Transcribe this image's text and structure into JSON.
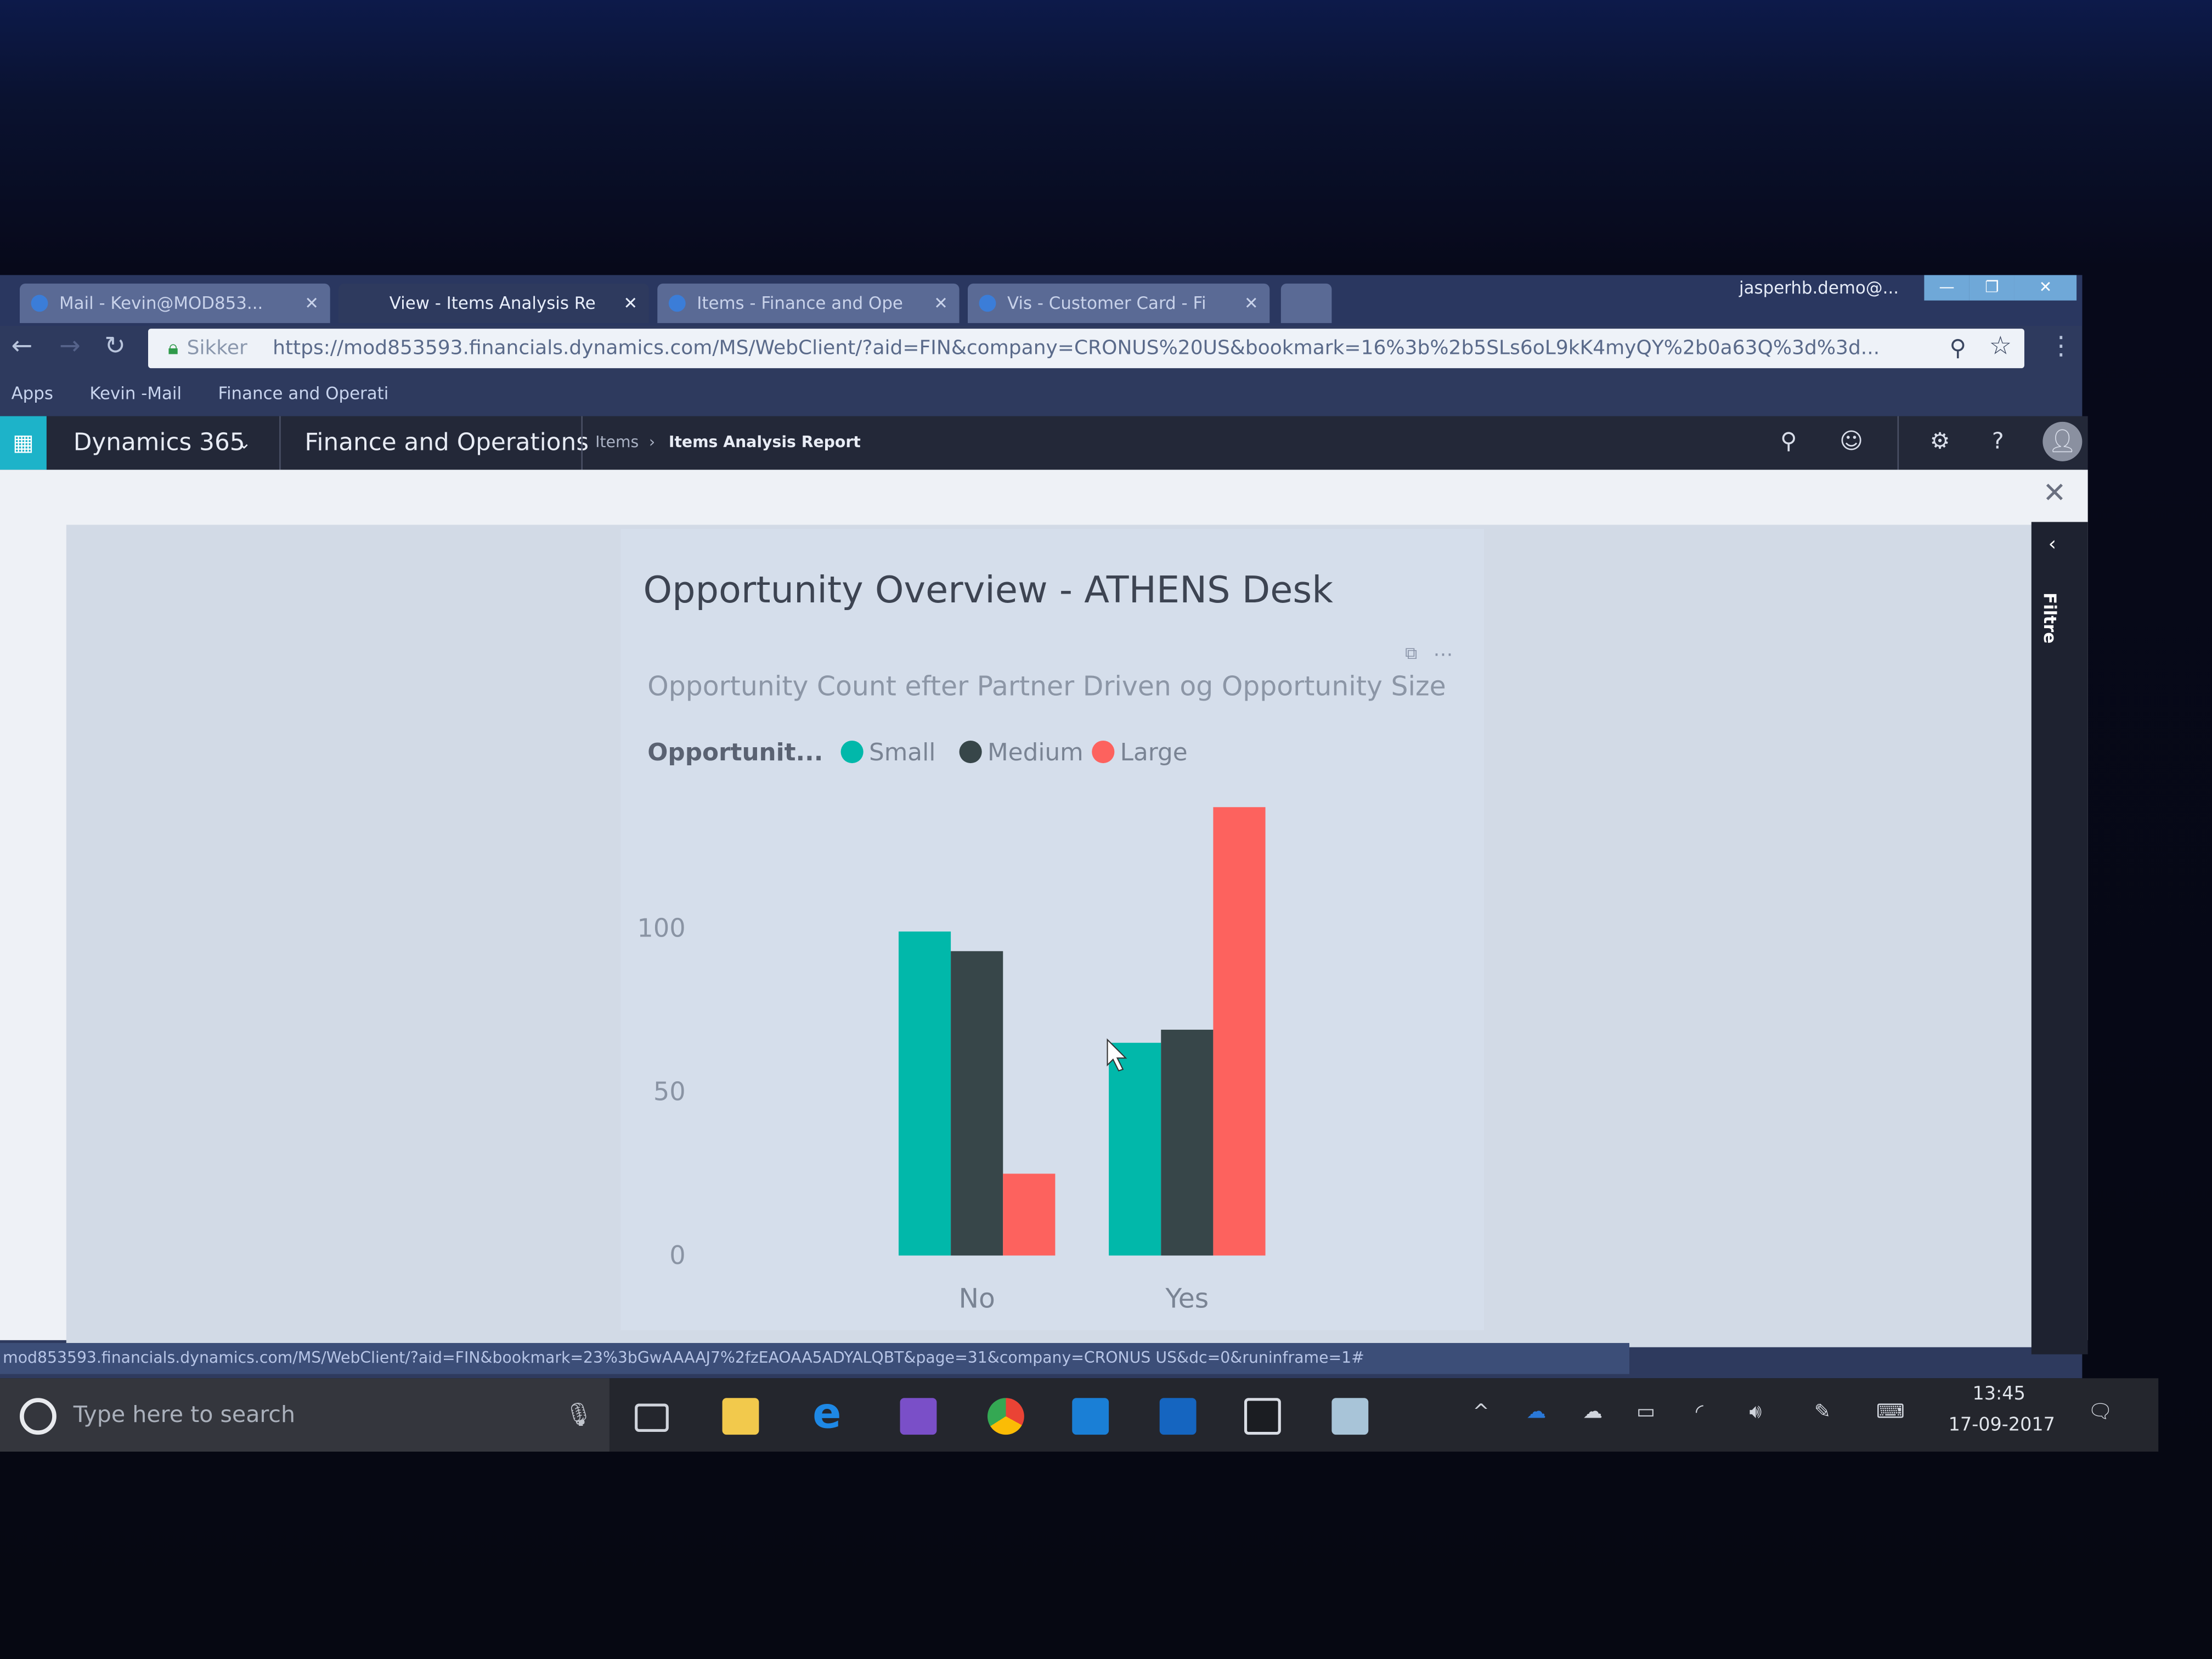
{
  "browser": {
    "tabs": [
      {
        "label": "Mail - Kevin@MOD853...",
        "active": false
      },
      {
        "label": "View - Items Analysis Re",
        "active": true
      },
      {
        "label": "Items - Finance and Ope",
        "active": false
      },
      {
        "label": "Vis - Customer Card - Fi",
        "active": false
      }
    ],
    "user": "jasperhb.demo@...",
    "security_label": "Sikker",
    "url": "https://mod853593.financials.dynamics.com/MS/WebClient/?aid=FIN&company=CRONUS%20US&bookmark=16%3b%2b5SLs6oL9kK4myQY%2b0a63Q%3d%3d...",
    "bookmarks": [
      "Apps",
      "Kevin -Mail",
      "Finance and Operati"
    ],
    "status_url": "mod853593.financials.dynamics.com/MS/WebClient/?aid=FIN&bookmark=23%3bGwAAAAJ7%2fzEAOAA5ADYALQBT&page=31&company=CRONUS US&dc=0&runinframe=1#"
  },
  "app": {
    "product": "Dynamics 365",
    "module": "Finance and Operations",
    "breadcrumb": [
      "Items",
      "Items Analysis Report"
    ],
    "filter_pane_label": "Filtre"
  },
  "report": {
    "title": "Opportunity  Overview - ATHENS Desk"
  },
  "chart_data": {
    "type": "bar",
    "title": "Opportunity Count efter Partner Driven og Opportunity Size",
    "legend_title": "Opportunit...",
    "legend_position": "top-left",
    "categories": [
      "No",
      "Yes"
    ],
    "series": [
      {
        "name": "Small",
        "color": "#01B8AA",
        "values": [
          99,
          65
        ]
      },
      {
        "name": "Medium",
        "color": "#374649",
        "values": [
          93,
          69
        ]
      },
      {
        "name": "Large",
        "color": "#FD625E",
        "values": [
          25,
          137
        ]
      }
    ],
    "yticks": [
      0,
      50,
      100
    ],
    "ylim": [
      0,
      140
    ],
    "grid": false
  },
  "taskbar": {
    "search_placeholder": "Type here to search",
    "time": "13:45",
    "date": "17-09-2017"
  }
}
